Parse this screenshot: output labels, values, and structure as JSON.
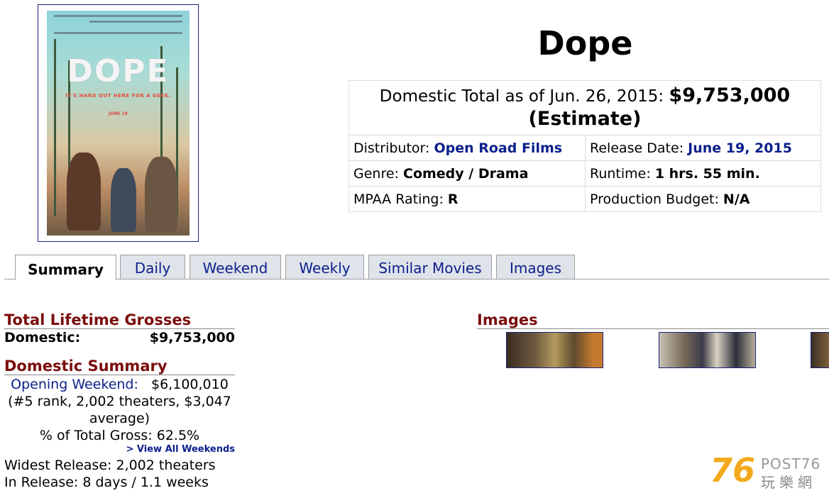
{
  "movie": {
    "title": "Dope",
    "domestic_total_label": "Domestic Total as of Jun. 26, 2015:",
    "domestic_total_value": "$9,753,000",
    "estimate": "(Estimate)",
    "distributor_label": "Distributor:",
    "distributor": "Open Road Films",
    "release_label": "Release Date:",
    "release_date": "June 19, 2015",
    "genre_label": "Genre:",
    "genre": "Comedy / Drama",
    "runtime_label": "Runtime:",
    "runtime": "1 hrs. 55 min.",
    "mpaa_label": "MPAA Rating:",
    "mpaa": "R",
    "budget_label": "Production Budget:",
    "budget": "N/A"
  },
  "poster": {
    "title_art": "DOPE",
    "tagline": "IT'S HARD OUT HERE FOR A GEEK.",
    "date": "JUNE 19"
  },
  "tabs": [
    {
      "label": "Summary",
      "active": true
    },
    {
      "label": "Daily"
    },
    {
      "label": "Weekend"
    },
    {
      "label": "Weekly"
    },
    {
      "label": "Similar Movies"
    },
    {
      "label": "Images"
    }
  ],
  "lifetime": {
    "heading": "Total Lifetime Grosses",
    "domestic_label": "Domestic:",
    "domestic_value": "$9,753,000"
  },
  "domestic_summary": {
    "heading": "Domestic Summary",
    "opening_label": "Opening Weekend:",
    "opening_value": "$6,100,010",
    "opening_detail_1": "(#5 rank, 2,002 theaters, $3,047",
    "opening_detail_2": "average)",
    "pct_total": "% of Total Gross: 62.5%",
    "view_all": "> View All Weekends",
    "widest_release": "Widest Release: 2,002 theaters",
    "in_release": "In Release: 8 days / 1.1 weeks"
  },
  "images": {
    "heading": "Images"
  },
  "watermark": {
    "number": "76",
    "brand": "POST76",
    "chinese": "玩樂網"
  },
  "colors": {
    "link": "#0b1f8c",
    "section_heading": "#7b0d0d",
    "watermark": "#f3a91b"
  }
}
